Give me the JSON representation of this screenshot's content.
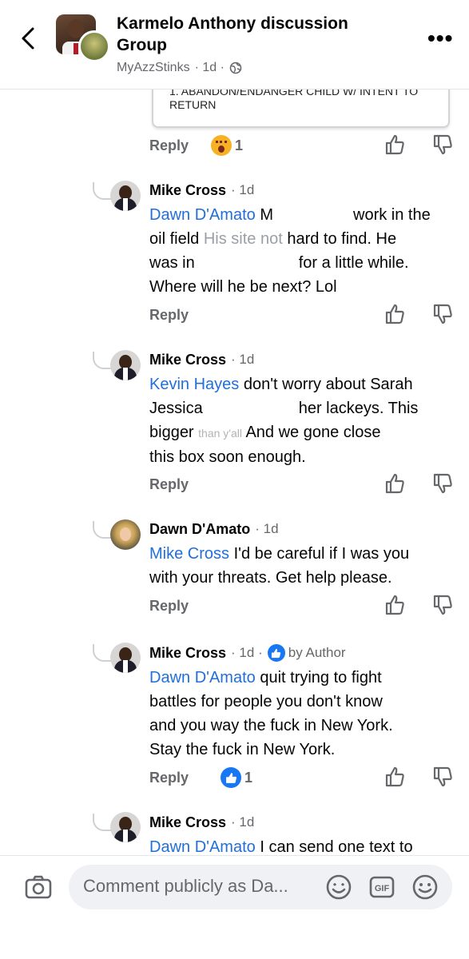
{
  "header": {
    "title": "Karmelo Anthony discussion Group",
    "author": "MyAzzStinks",
    "time": "· 1d ·"
  },
  "quoted_card": {
    "line1": "1. ABANDON/ENDANGER CHILD W/ INTENT TO",
    "line2": "RETURN"
  },
  "top_reply_row": {
    "reply_label": "Reply",
    "reaction_count": "1"
  },
  "comments": [
    {
      "name": "Mike Cross",
      "time": "· 1d",
      "mention": "Dawn D'Amato",
      "lines": [
        "M",
        "work in the",
        "oil field",
        "His site not",
        "hard to find. He",
        "was in",
        "for a little while.",
        "Where will he be next? Lol"
      ],
      "reply_label": "Reply"
    },
    {
      "name": "Mike Cross",
      "time": "· 1d",
      "mention": "Kevin Hayes",
      "lines": [
        "don't worry about Sarah",
        "Jessica",
        "her lackeys. This",
        "bigger",
        "than y'all",
        "And we gone close",
        "this box soon enough."
      ],
      "reply_label": "Reply"
    },
    {
      "name": "Dawn D'Amato",
      "time": "· 1d",
      "mention": "Mike Cross",
      "lines": [
        "I'd be careful if I was you",
        "with your threats.  Get help please."
      ],
      "reply_label": "Reply"
    },
    {
      "name": "Mike Cross",
      "time": "· 1d ·",
      "badge": "by Author",
      "mention": "Dawn D'Amato",
      "lines": [
        "quit trying to fight",
        "battles for people you don't know",
        "and you way the fuck in New York.",
        "Stay the fuck in New York."
      ],
      "reply_label": "Reply",
      "reaction_count": "1"
    },
    {
      "name": "Mike Cross",
      "time": "· 1d",
      "mention": "Dawn D'Amato",
      "lines": [
        "I can send one text to"
      ]
    }
  ],
  "composer": {
    "placeholder": "Comment publicly as Da..."
  },
  "icons": {
    "back": "chevron-left-icon",
    "more": "more-dots-icon",
    "globe": "globe-icon",
    "like": "thumbs-up-icon",
    "dislike": "thumbs-down-icon",
    "camera": "camera-icon",
    "avatar_sticker": "sticker-icon",
    "gif": "gif-icon",
    "emoji": "emoji-icon"
  }
}
